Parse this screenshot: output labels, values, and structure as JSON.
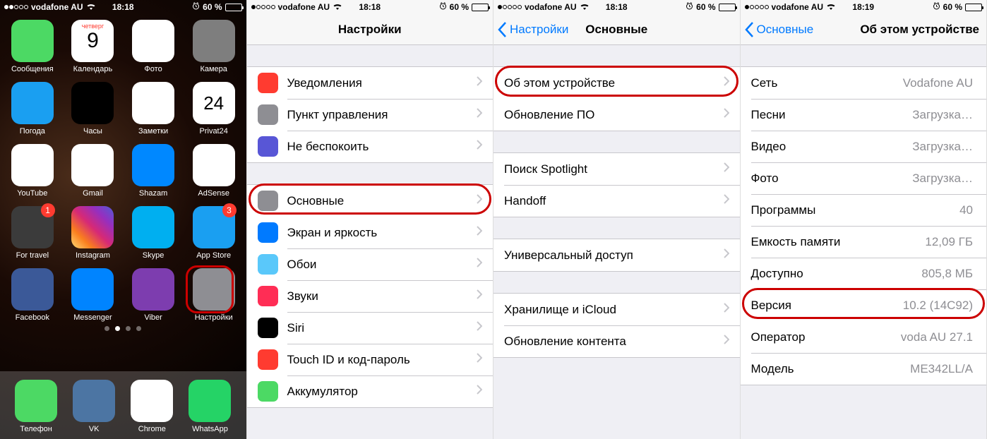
{
  "status": {
    "carrier": "vodafone AU",
    "time1": "18:18",
    "time2": "18:18",
    "time3": "18:18",
    "time4": "18:19",
    "battery_pct": "60 %"
  },
  "home": {
    "apps": [
      {
        "label": "Сообщения",
        "color": "#4cd964"
      },
      {
        "label": "Календарь",
        "color": "#fff",
        "text": "9",
        "toptext": "четверг"
      },
      {
        "label": "Фото",
        "color": "#fff"
      },
      {
        "label": "Камера",
        "color": "#7e7e7e"
      },
      {
        "label": "Погода",
        "color": "#1a9ff1"
      },
      {
        "label": "Часы",
        "color": "#000"
      },
      {
        "label": "Заметки",
        "color": "#fff"
      },
      {
        "label": "Privat24",
        "color": "#fff",
        "text": "24"
      },
      {
        "label": "YouTube",
        "color": "#fff"
      },
      {
        "label": "Gmail",
        "color": "#fff"
      },
      {
        "label": "Shazam",
        "color": "#0088ff"
      },
      {
        "label": "AdSense",
        "color": "#fff"
      },
      {
        "label": "For travel",
        "color": "#3b3b3b",
        "badge": "1"
      },
      {
        "label": "Instagram",
        "color": "linear"
      },
      {
        "label": "Skype",
        "color": "#00aff0"
      },
      {
        "label": "App Store",
        "color": "#1a9ff1",
        "badge": "3"
      },
      {
        "label": "Facebook",
        "color": "#3b5998"
      },
      {
        "label": "Messenger",
        "color": "#0084ff"
      },
      {
        "label": "Viber",
        "color": "#7d3daf"
      },
      {
        "label": "Настройки",
        "color": "#8e8e93",
        "highlight": true
      }
    ],
    "dock": [
      {
        "label": "Телефон",
        "color": "#4cd964"
      },
      {
        "label": "VK",
        "color": "#4c75a3"
      },
      {
        "label": "Chrome",
        "color": "#fff"
      },
      {
        "label": "WhatsApp",
        "color": "#25d366"
      }
    ]
  },
  "settings": {
    "title": "Настройки",
    "rows": [
      {
        "icon": "ic-notif",
        "label": "Уведомления"
      },
      {
        "icon": "ic-cc",
        "label": "Пункт управления"
      },
      {
        "icon": "ic-dnd",
        "label": "Не беспокоить"
      }
    ],
    "rows2": [
      {
        "icon": "ic-general",
        "label": "Основные",
        "highlight": true
      },
      {
        "icon": "ic-display",
        "label": "Экран и яркость"
      },
      {
        "icon": "ic-wallpaper",
        "label": "Обои"
      },
      {
        "icon": "ic-sounds",
        "label": "Звуки"
      },
      {
        "icon": "ic-siri",
        "label": "Siri"
      },
      {
        "icon": "ic-touchid",
        "label": "Touch ID и код-пароль"
      },
      {
        "icon": "ic-battery",
        "label": "Аккумулятор"
      }
    ]
  },
  "general": {
    "back": "Настройки",
    "title": "Основные",
    "rows": [
      {
        "label": "Об этом устройстве",
        "highlight": true
      },
      {
        "label": "Обновление ПО"
      }
    ],
    "rows2": [
      {
        "label": "Поиск Spotlight"
      },
      {
        "label": "Handoff"
      }
    ],
    "rows3": [
      {
        "label": "Универсальный доступ"
      }
    ],
    "rows4": [
      {
        "label": "Хранилище и iCloud"
      },
      {
        "label": "Обновление контента"
      }
    ]
  },
  "about": {
    "back": "Основные",
    "title": "Об этом устройстве",
    "rows": [
      {
        "label": "Сеть",
        "value": "Vodafone AU"
      },
      {
        "label": "Песни",
        "value": "Загрузка…"
      },
      {
        "label": "Видео",
        "value": "Загрузка…"
      },
      {
        "label": "Фото",
        "value": "Загрузка…"
      },
      {
        "label": "Программы",
        "value": "40"
      },
      {
        "label": "Емкость памяти",
        "value": "12,09 ГБ"
      },
      {
        "label": "Доступно",
        "value": "805,8 МБ"
      },
      {
        "label": "Версия",
        "value": "10.2 (14C92)",
        "highlight": true
      },
      {
        "label": "Оператор",
        "value": "voda AU 27.1"
      },
      {
        "label": "Модель",
        "value": "ME342LL/A"
      }
    ]
  }
}
